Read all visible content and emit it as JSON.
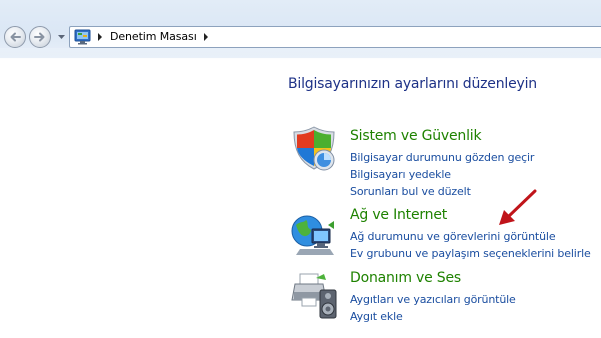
{
  "navbar": {
    "back_icon": "back-arrow-icon",
    "forward_icon": "forward-arrow-icon",
    "address_icon": "control-panel-icon",
    "breadcrumb": "Denetim Masası"
  },
  "main": {
    "title": "Bilgisayarınızın ayarlarını düzenleyin",
    "categories": [
      {
        "title": "Sistem ve Güvenlik",
        "icon": "shield-icon",
        "links": [
          "Bilgisayar durumunu gözden geçir",
          "Bilgisayarı yedekle",
          "Sorunları bul ve düzelt"
        ]
      },
      {
        "title": "Ağ ve Internet",
        "icon": "network-globe-icon",
        "links": [
          "Ağ durumunu ve görevlerini görüntüle",
          "Ev grubunu ve paylaşım seçeneklerini belirle"
        ]
      },
      {
        "title": "Donanım ve Ses",
        "icon": "printer-speaker-icon",
        "links": [
          "Aygıtları ve yazıcıları görüntüle",
          "Aygıt ekle"
        ]
      }
    ]
  },
  "colors": {
    "title_blue": "#1e3287",
    "category_green": "#1e8200",
    "link_blue": "#1b4ea0",
    "annotation_red": "#c0141a"
  }
}
